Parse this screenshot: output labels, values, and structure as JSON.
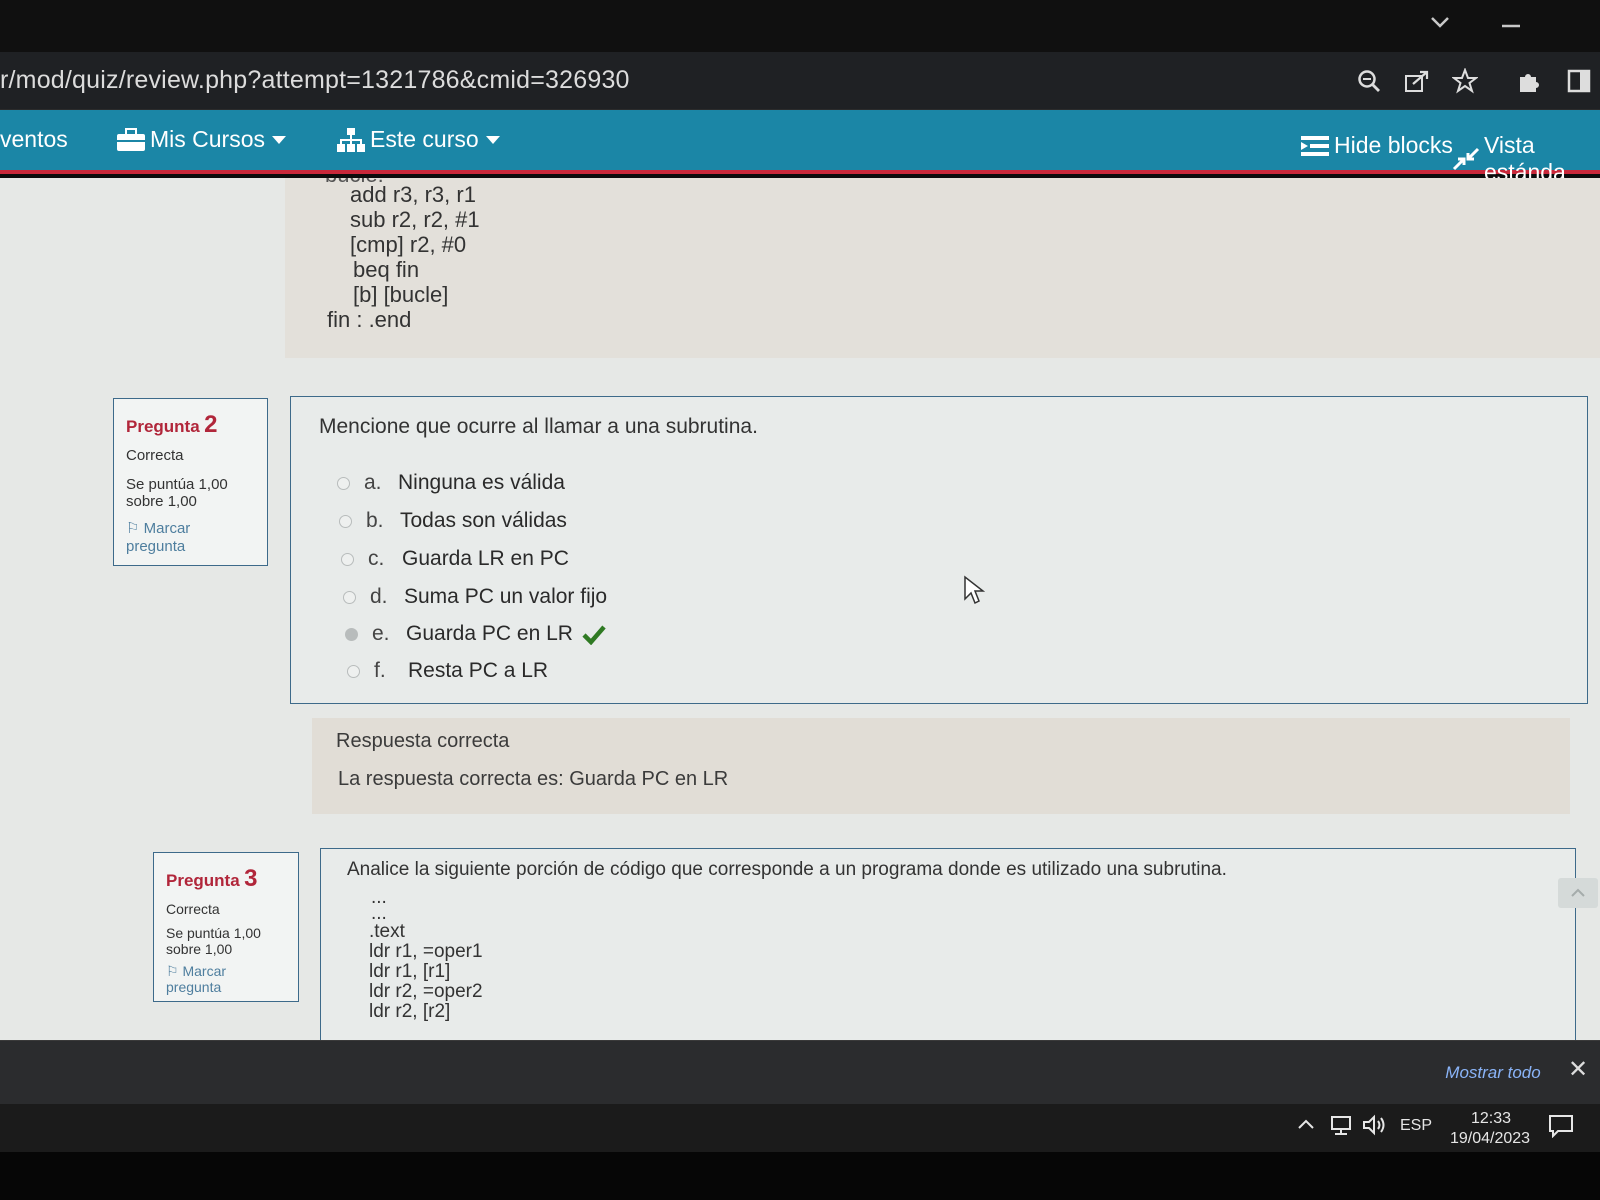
{
  "browser": {
    "url": "r/mod/quiz/review.php?attempt=1321786&cmid=326930",
    "icons": [
      "zoom-icon",
      "share-icon",
      "star-icon",
      "extensions-icon",
      "side-panel-icon"
    ]
  },
  "nav": {
    "eventos": "ventos",
    "mis_cursos": "Mis Cursos",
    "este_curso": "Este curso",
    "hide_blocks": "Hide blocks",
    "vista_estandar": "Vista estánda"
  },
  "code_top": {
    "partial": "bucle:",
    "lines": [
      "add r3, r3, r1",
      "sub r2, r2, #1",
      "[cmp] r2, #0",
      "beq fin",
      "[b] [bucle]",
      "fin : .end"
    ]
  },
  "question2": {
    "label": "Pregunta",
    "number": "2",
    "state": "Correcta",
    "grade_line1": "Se puntúa 1,00",
    "grade_line2": "sobre 1,00",
    "flag_line1": "Marcar",
    "flag_line2": "pregunta",
    "text": "Mencione que ocurre al llamar a una subrutina.",
    "answers": [
      {
        "letter": "a.",
        "text": "Ninguna es válida",
        "selected": false
      },
      {
        "letter": "b.",
        "text": "Todas son válidas",
        "selected": false
      },
      {
        "letter": "c.",
        "text": "Guarda LR en PC",
        "selected": false
      },
      {
        "letter": "d.",
        "text": "Suma PC un valor fijo",
        "selected": false
      },
      {
        "letter": "e.",
        "text": "Guarda PC en LR",
        "selected": true,
        "correct": true
      },
      {
        "letter": "f.",
        "text": "Resta PC a LR",
        "selected": false
      }
    ],
    "feedback_title": "Respuesta correcta",
    "feedback_text": "La respuesta correcta es: Guarda PC en LR"
  },
  "question3": {
    "label": "Pregunta",
    "number": "3",
    "state": "Correcta",
    "grade_line1": "Se puntúa 1,00",
    "grade_line2": "sobre 1,00",
    "flag_line1": "Marcar",
    "flag_line2": "pregunta",
    "text": "Analice la siguiente porción de código que corresponde a un programa donde es utilizado una subrutina.",
    "code": [
      "...",
      "...",
      ".text",
      "ldr r1, =oper1",
      "ldr r1, [r1]",
      "ldr r2, =oper2",
      "ldr r2, [r2]"
    ]
  },
  "downloads": {
    "show_all": "Mostrar todo",
    "close": "✕"
  },
  "taskbar": {
    "language": "ESP",
    "time": "12:33",
    "date": "19/04/2023"
  },
  "colors": {
    "nav_bg": "#1b86a6",
    "nav_accent": "#c8283a",
    "question_label": "#b1263a",
    "check": "#2f7a23"
  }
}
